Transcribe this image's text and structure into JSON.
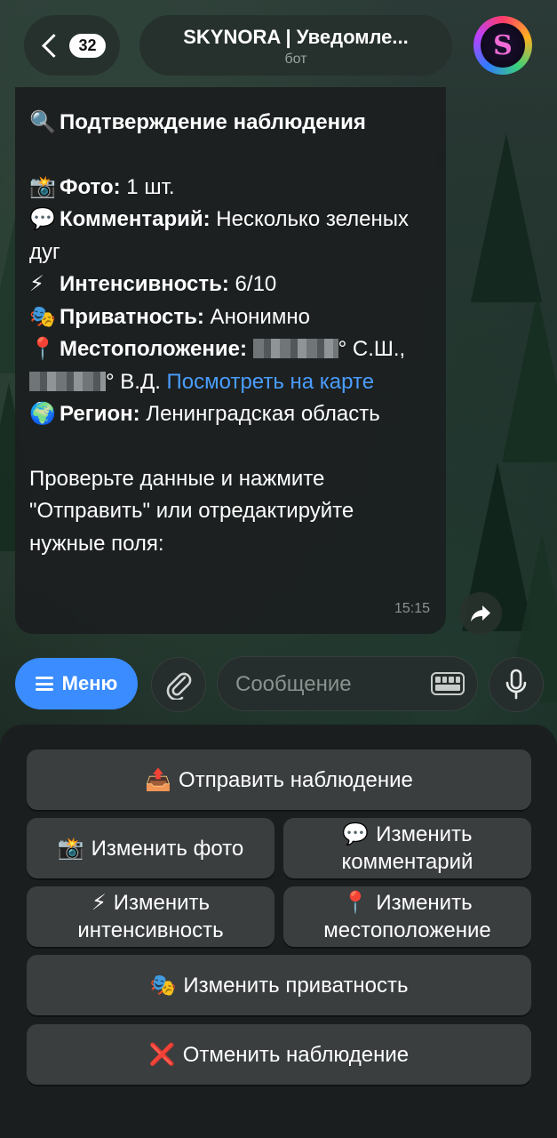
{
  "header": {
    "back_badge": "32",
    "title": "SKYNORA | Уведомле...",
    "subtitle": "бот"
  },
  "message": {
    "heading_icon": "🔍",
    "heading": "Подтверждение наблюдения",
    "photo_icon": "📸",
    "photo_label": "Фото:",
    "photo_value": " 1 шт.",
    "comment_icon": "💬",
    "comment_label": "Комментарий:",
    "comment_value": " Несколько зеленых дуг",
    "intensity_icon": "⚡",
    "intensity_label": "Интенсивность:",
    "intensity_value": " 6/10",
    "privacy_icon": "🎭",
    "privacy_label": "Приватность:",
    "privacy_value": " Анонимно",
    "location_icon": "📍",
    "location_label": "Местоположение:",
    "lat_suffix": "° С.Ш., ",
    "lon_suffix": "° В.Д. ",
    "map_link": "Посмотреть на карте",
    "region_icon": "🌍",
    "region_label": "Регион:",
    "region_value": " Ленинградская область",
    "footer_text": "Проверьте данные и нажмите \"Отправить\" или отредактируйте нужные поля:",
    "time": "15:15"
  },
  "input_bar": {
    "menu_label": "Меню",
    "message_placeholder": "Сообщение"
  },
  "keyboard": {
    "send": {
      "icon": "📤",
      "label": "Отправить наблюдение"
    },
    "edit_photo": {
      "icon": "📸",
      "label": "Изменить фото"
    },
    "edit_comment": {
      "icon": "💬",
      "line1": "Изменить",
      "line2": "комментарий"
    },
    "edit_intensity": {
      "icon": "⚡",
      "line1": "Изменить",
      "line2": "интенсивность"
    },
    "edit_location": {
      "icon": "📍",
      "line1": "Изменить",
      "line2": "местоположение"
    },
    "edit_privacy": {
      "icon": "🎭",
      "label": "Изменить приватность"
    },
    "cancel": {
      "icon": "❌",
      "label": "Отменить наблюдение"
    }
  },
  "colors": {
    "accent": "#3a8cff",
    "link": "#4a9dff",
    "bubble": "#1b1f20",
    "keyboard_button": "#3a3e3f"
  }
}
